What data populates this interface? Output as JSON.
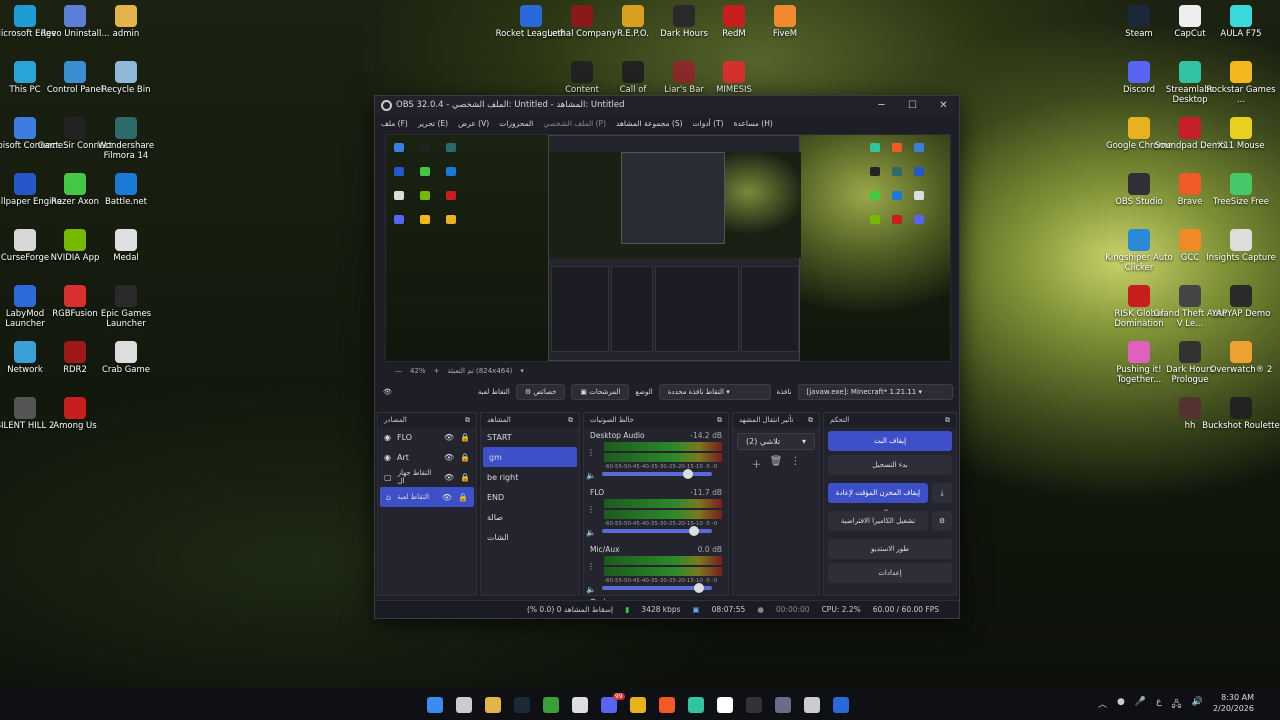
{
  "desktop_icons": [
    {
      "label": "Microsoft Edge",
      "color": "#1f9bd6"
    },
    {
      "label": "Revo Uninstall...",
      "color": "#5b7fd6"
    },
    {
      "label": "admin",
      "color": "#e2b44a"
    },
    {
      "label": "This PC",
      "color": "#2aa3d8"
    },
    {
      "label": "Control Panel",
      "color": "#3a8fd0"
    },
    {
      "label": "Recycle Bin",
      "color": "#8fb8d8"
    },
    {
      "label": "Ubisoft Connect",
      "color": "#3b7de0"
    },
    {
      "label": "GameSir Connect",
      "color": "#222222"
    },
    {
      "label": "Wondershare Filmora 14",
      "color": "#2d6a6a"
    },
    {
      "label": "Wallpaper Engine",
      "color": "#2458c8"
    },
    {
      "label": "Razer Axon",
      "color": "#44c844"
    },
    {
      "label": "Battle.net",
      "color": "#1a7ad8"
    },
    {
      "label": "CurseForge",
      "color": "#d8d8d8"
    },
    {
      "label": "NVIDIA App",
      "color": "#76b900"
    },
    {
      "label": "Medal",
      "color": "#e0e0e0"
    },
    {
      "label": "LabyMod Launcher",
      "color": "#2c6ad8"
    },
    {
      "label": "RGBFusion",
      "color": "#d83030"
    },
    {
      "label": "Epic Games Launcher",
      "color": "#2a2a2a"
    },
    {
      "label": "Network",
      "color": "#3aa0d8"
    },
    {
      "label": "RDR2",
      "color": "#a01818"
    },
    {
      "label": "Crab Game",
      "color": "#dddddd"
    },
    {
      "label": "SILENT HILL 2",
      "color": "#555555"
    },
    {
      "label": "Among Us",
      "color": "#c81e1e"
    },
    {
      "label": "Rocket League®",
      "color": "#2a6ad8"
    },
    {
      "label": "Lethal Company",
      "color": "#8a1a1a"
    },
    {
      "label": "R.E.P.O.",
      "color": "#d8a020"
    },
    {
      "label": "Dark Hours",
      "color": "#2a2a2a"
    },
    {
      "label": "RedM",
      "color": "#c81e1e"
    },
    {
      "label": "FiveM",
      "color": "#f08a30"
    },
    {
      "label": "Content",
      "color": "#222222"
    },
    {
      "label": "Call of",
      "color": "#222222"
    },
    {
      "label": "Liar's Bar",
      "color": "#8a2a2a"
    },
    {
      "label": "MIMESIS",
      "color": "#d83030"
    },
    {
      "label": "Steam",
      "color": "#1b2838"
    },
    {
      "label": "CapCut",
      "color": "#eeeeee"
    },
    {
      "label": "AULA F75",
      "color": "#3ad8d8"
    },
    {
      "label": "Discord",
      "color": "#5865f2"
    },
    {
      "label": "Streamlabs Desktop",
      "color": "#31c3a2"
    },
    {
      "label": "Rockstar Games ...",
      "color": "#f2b81e"
    },
    {
      "label": "Google Chrome",
      "color": "#e8b21e"
    },
    {
      "label": "Soundpad Demo",
      "color": "#c81e2a"
    },
    {
      "label": "X11 Mouse",
      "color": "#e8d01e"
    },
    {
      "label": "OBS Studio",
      "color": "#303036"
    },
    {
      "label": "Brave",
      "color": "#f05a24"
    },
    {
      "label": "TreeSize Free",
      "color": "#44c868"
    },
    {
      "label": "Kingshiper Auto Clicker",
      "color": "#2a8ad8"
    },
    {
      "label": "GCC",
      "color": "#f08a24"
    },
    {
      "label": "Insights Capture",
      "color": "#dddddd"
    },
    {
      "label": "RISK Global Domination",
      "color": "#c81e1e"
    },
    {
      "label": "Grand Theft Auto V Le...",
      "color": "#444444"
    },
    {
      "label": "YAPYAP Demo",
      "color": "#2a2a2a"
    },
    {
      "label": "Pushing it! Together...",
      "color": "#e060c0"
    },
    {
      "label": "Dark Hours Prologue",
      "color": "#333333"
    },
    {
      "label": "Overwatch® 2",
      "color": "#f0a030"
    },
    {
      "label": "hh",
      "color": "#553333"
    },
    {
      "label": "Buckshot Roulette",
      "color": "#222222"
    }
  ],
  "obs": {
    "title": "OBS 32.0.4 - الملف الشخصي: Untitled - المشاهد: Untitled",
    "window_buttons": {
      "minimize": "─",
      "maximize": "☐",
      "close": "✕"
    },
    "menu": [
      "ملف (F)",
      "تحرير (E)",
      "عرض (V)",
      "المحزوزات",
      "الملف الشخصي (P)",
      "مجموعة المشاهد (S)",
      "أدوات (T)",
      "مساعدة (H)"
    ],
    "zoom": "42%",
    "zoom_plus": "+",
    "canvas_label": "تم التعبئة (824x464)",
    "scene_toolbar": {
      "source_name": "التقاط لعبة",
      "properties": "خصائص",
      "filters": "المرشحات",
      "mode_label": "الوضع",
      "mode_value": "التقاط نافذة محددة",
      "window_label": "نافذة",
      "window_value": "[javaw.exe]: Minecraft* 1.21.11"
    },
    "sources": {
      "title": "المصادر",
      "items": [
        {
          "name": "FLO"
        },
        {
          "name": "Art"
        },
        {
          "name": "التقاط جهاز ال"
        },
        {
          "name": "التقاط لعبة"
        }
      ]
    },
    "scenes": {
      "title": "المشاهد",
      "items": [
        "START",
        "gm",
        "be right",
        "END",
        "صالة",
        "الشات"
      ],
      "selected": 1
    },
    "mixer": {
      "title": "خالط الصوتيات",
      "channels": [
        {
          "name": "Desktop Audio",
          "level": "-14.2 dB",
          "vol": 0.8
        },
        {
          "name": "FLO",
          "level": "-11.7 dB",
          "vol": 0.85
        },
        {
          "name": "Mic/Aux",
          "level": "0.0 dB",
          "vol": 0.9
        }
      ],
      "scale": "-60-55-50-45-40-35-30-25-20-15-10 -5 -0"
    },
    "transitions": {
      "title": "تأثير انتقال المشهد",
      "value": "تلاشي (2)"
    },
    "controls": {
      "title": "التحكم",
      "buttons": [
        "إيقاف البث",
        "بدء التسجيل",
        "إيقاف المخزن المؤقت لإعادة العرض",
        "تشغيل الكاميرا الافتراضية",
        "طور الاستديو",
        "إعدادات"
      ]
    },
    "status": {
      "dropped": "إسقاط المشاهد 0 (0.0 %)",
      "bitrate": "3428 kbps",
      "stream_time": "08:07:55",
      "rec_time": "00:00:00",
      "cpu": "CPU: 2.2%",
      "fps": "60.00 / 60.00 FPS"
    }
  },
  "taskbar": {
    "tray_lang": "ع",
    "time": "8:30 AM",
    "date": "2/20/2026",
    "badge": "99"
  }
}
